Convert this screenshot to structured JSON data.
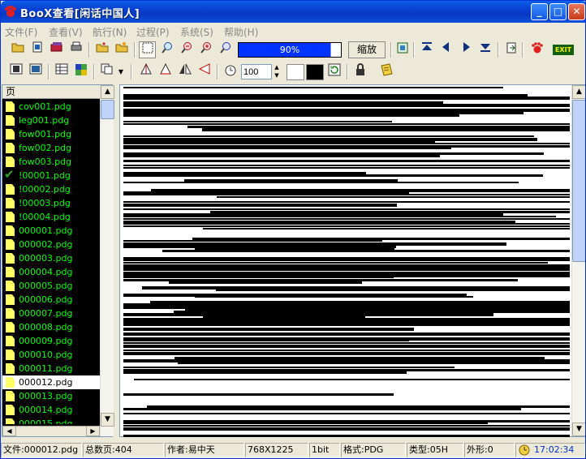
{
  "window": {
    "title": "BooX查看[闲话中国人]"
  },
  "menu": [
    {
      "label": "文件(F)"
    },
    {
      "label": "查看(V)"
    },
    {
      "label": "航行(N)"
    },
    {
      "label": "过程(P)"
    },
    {
      "label": "系统(S)"
    },
    {
      "label": "帮助(H)"
    }
  ],
  "toolbar": {
    "zoom_bar_label": "90%",
    "zoom_level_fraction": 0.9,
    "zoom_button_label": "缩放",
    "percent_input_value": "100",
    "exit_label": "EXIT"
  },
  "sidebar": {
    "header": "页",
    "files": [
      {
        "name": "cov001.pdg",
        "state": "normal"
      },
      {
        "name": "leg001.pdg",
        "state": "normal"
      },
      {
        "name": "fow001.pdg",
        "state": "normal"
      },
      {
        "name": "fow002.pdg",
        "state": "normal"
      },
      {
        "name": "fow003.pdg",
        "state": "normal"
      },
      {
        "name": "!00001.pdg",
        "state": "checked"
      },
      {
        "name": "!00002.pdg",
        "state": "normal"
      },
      {
        "name": "!00003.pdg",
        "state": "normal"
      },
      {
        "name": "!00004.pdg",
        "state": "normal"
      },
      {
        "name": "000001.pdg",
        "state": "normal"
      },
      {
        "name": "000002.pdg",
        "state": "normal"
      },
      {
        "name": "000003.pdg",
        "state": "normal"
      },
      {
        "name": "000004.pdg",
        "state": "normal"
      },
      {
        "name": "000005.pdg",
        "state": "normal"
      },
      {
        "name": "000006.pdg",
        "state": "normal"
      },
      {
        "name": "000007.pdg",
        "state": "normal"
      },
      {
        "name": "000008.pdg",
        "state": "normal"
      },
      {
        "name": "000009.pdg",
        "state": "normal"
      },
      {
        "name": "000010.pdg",
        "state": "normal"
      },
      {
        "name": "000011.pdg",
        "state": "normal"
      },
      {
        "name": "000012.pdg",
        "state": "selected"
      },
      {
        "name": "000013.pdg",
        "state": "normal"
      },
      {
        "name": "000014.pdg",
        "state": "normal"
      },
      {
        "name": "000015.pdg",
        "state": "normal"
      }
    ]
  },
  "status": {
    "file": "文件:000012.pdg",
    "total_pages": "总数页:404",
    "author": "作者:易中天",
    "dimensions": "768X1225",
    "bit_depth": "1bit",
    "format": "格式:PDG",
    "type": "类型:05H",
    "shape": "外形:0",
    "time": "17:02:34"
  },
  "colors": {
    "title_bar": "#0a3fd0",
    "file_text": "#00ff00",
    "zoom_bar": "#0033ff",
    "page_ink": "#000000"
  }
}
